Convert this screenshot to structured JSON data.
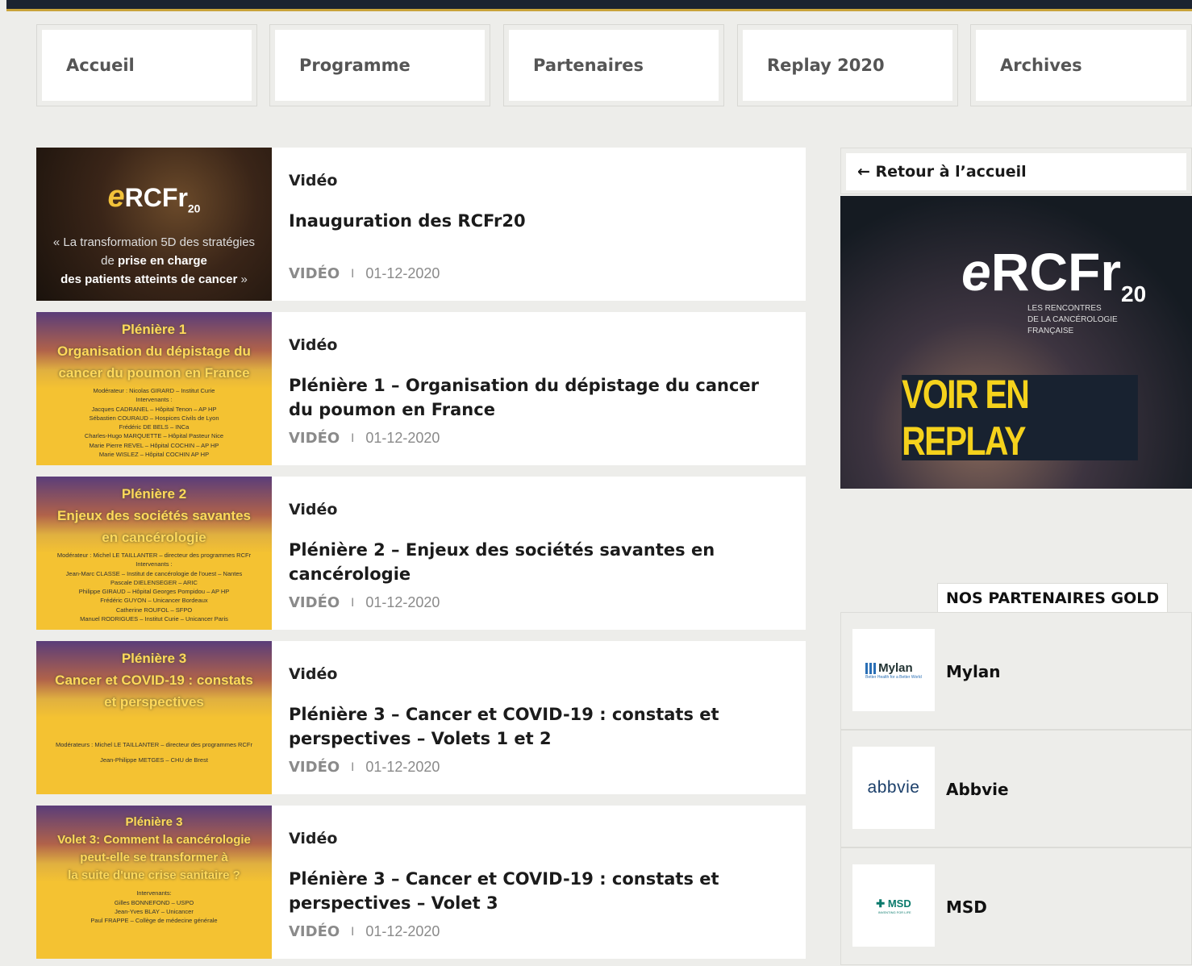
{
  "nav": {
    "items": [
      {
        "label": "Accueil"
      },
      {
        "label": "Programme"
      },
      {
        "label": "Partenaires"
      },
      {
        "label": "Replay 2020"
      },
      {
        "label": "Archives"
      }
    ]
  },
  "videos": [
    {
      "type": "Vidéo",
      "title": "Inauguration des RCFr20",
      "meta_label": "VIDÉO",
      "separator": "I",
      "date": "01-12-2020",
      "thumb": {
        "style": "dark",
        "logo_e": "e",
        "logo_main": "RCFr",
        "logo_sub": "20",
        "quote_l1": "« La transformation 5D des stratégies",
        "quote_l2_pre": "de ",
        "quote_l2_bold": "prise en charge",
        "quote_l3_bold": "des patients atteints de cancer",
        "quote_l3_post": " »"
      }
    },
    {
      "type": "Vidéo",
      "title": "Plénière 1 – Organisation du dépistage du cancer du poumon en France",
      "meta_label": "VIDÉO",
      "separator": "I",
      "date": "01-12-2020",
      "thumb": {
        "style": "yellow",
        "heading": [
          "Plénière 1",
          "Organisation du dépistage du",
          "cancer du poumon en France"
        ],
        "lines": [
          "Modérateur : Nicolas GIRARD – Institut Curie",
          "Intervenants :",
          "Jacques CADRANEL – Hôpital Tenon – AP HP",
          "Sébastien COURAUD – Hospices Civils de Lyon",
          "Frédéric DE BELS – INCa",
          "Charles-Hugo MARQUETTE – Hôpital Pasteur Nice",
          "Marie Pierre REVEL – Hôpital COCHIN – AP HP",
          "Marie WISLEZ – Hôpital COCHIN AP HP"
        ]
      }
    },
    {
      "type": "Vidéo",
      "title": "Plénière 2 – Enjeux des sociétés savantes en cancérologie",
      "meta_label": "VIDÉO",
      "separator": "I",
      "date": "01-12-2020",
      "thumb": {
        "style": "yellow",
        "heading": [
          "Plénière 2",
          "Enjeux des sociétés savantes",
          "en cancérologie"
        ],
        "lines": [
          "Modérateur : Michel LE TAILLANTER – directeur des programmes RCFr",
          "Intervenants :",
          "Jean-Marc CLASSE – Institut de cancérologie de l'ouest – Nantes",
          "Pascale DIELENSEGER – ARIC",
          "Philippe GIRAUD – Hôpital Georges Pompidou – AP HP",
          "Frédéric GUYON – Unicancer Bordeaux",
          "Catherine ROUFOL – SFPO",
          "Manuel RODRIGUES – Institut Curie – Unicancer Paris"
        ]
      }
    },
    {
      "type": "Vidéo",
      "title": "Plénière 3 – Cancer et COVID-19 : constats et perspectives – Volets 1 et 2",
      "meta_label": "VIDÉO",
      "separator": "I",
      "date": "01-12-2020",
      "thumb": {
        "style": "yellow",
        "heading": [
          "Plénière 3",
          "Cancer et COVID-19 : constats",
          "et perspectives"
        ],
        "lines": [
          "Modérateurs : Michel LE TAILLANTER – directeur des programmes RCFr",
          "Jean-Philippe METGES – CHU de Brest"
        ]
      }
    },
    {
      "type": "Vidéo",
      "title": "Plénière 3 – Cancer et COVID-19 : constats et perspectives – Volet 3",
      "meta_label": "VIDÉO",
      "separator": "I",
      "date": "01-12-2020",
      "thumb": {
        "style": "yellow",
        "heading": [
          "Plénière 3",
          "Volet 3: Comment la cancérologie",
          "peut-elle se transformer à",
          "la suite d'une crise sanitaire ?"
        ],
        "lines": [
          "Intervenants:",
          "Gilles BONNEFOND – USPO",
          "Jean-Yves BLAY – Unicancer",
          "Paul FRAPPE – Collège de médecine générale"
        ]
      }
    }
  ],
  "sidebar": {
    "back_label": "← Retour à l’accueil",
    "banner": {
      "logo_e": "e",
      "logo_main": "RCFr",
      "logo_sub": "20",
      "sub_lines": [
        "LES RENCONTRES",
        "DE LA CANCÉROLOGIE",
        "FRANÇAISE"
      ],
      "cta": "VOIR EN REPLAY"
    },
    "gold_title": "NOS PARTENAIRES GOLD",
    "partners": [
      {
        "name": "Mylan",
        "logo_text": "Mylan",
        "logo_tagline": "Better Health for a Better World"
      },
      {
        "name": "Abbvie",
        "logo_text": "abbvie"
      },
      {
        "name": "MSD",
        "logo_text": "MSD",
        "logo_tagline": "INVENTING FOR LIFE"
      }
    ]
  },
  "colors": {
    "accent": "#f4c232",
    "dark": "#1c2330",
    "cta_text": "#f5d21c"
  }
}
